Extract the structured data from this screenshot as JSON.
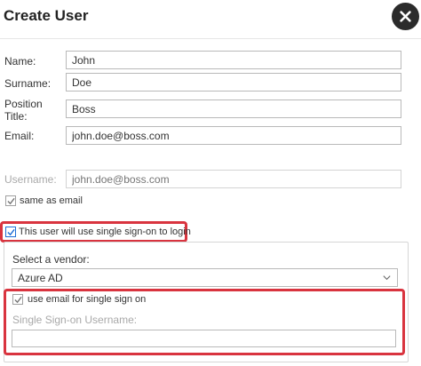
{
  "dialog": {
    "title": "Create User"
  },
  "form": {
    "name_label": "Name:",
    "name_value": "John",
    "surname_label": "Surname:",
    "surname_value": "Doe",
    "position_label_line1": "Position",
    "position_label_line2": "Title:",
    "position_value": "Boss",
    "email_label": "Email:",
    "email_value": "john.doe@boss.com",
    "username_label": "Username:",
    "username_placeholder": "john.doe@boss.com",
    "same_as_email_label": "same as email",
    "same_as_email_checked": true,
    "sso_label": "This user will use single sign-on to login",
    "sso_checked": true
  },
  "sso": {
    "vendor_label": "Select a vendor:",
    "vendor_value": "Azure AD",
    "use_email_label": "use email for single sign on",
    "use_email_checked": true,
    "sso_username_label": "Single Sign-on Username:",
    "sso_username_value": ""
  },
  "colors": {
    "highlight": "#d9343f",
    "checkbox_blue": "#1f6fd6"
  }
}
